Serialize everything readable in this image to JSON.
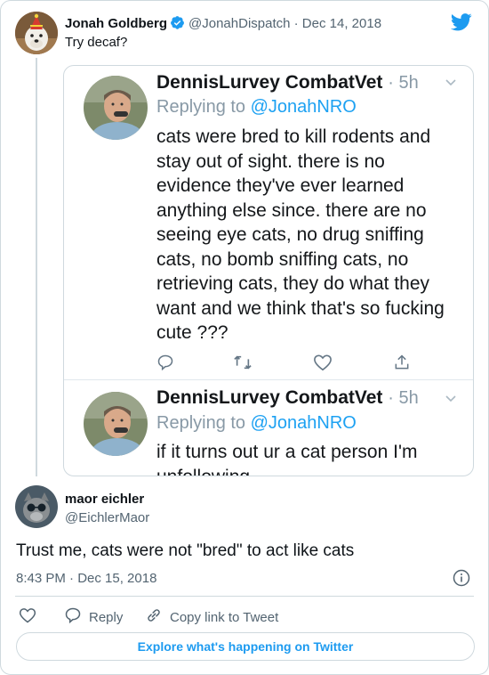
{
  "parent": {
    "name": "Jonah Goldberg",
    "handle_date": "@JonahDispatch · Dec 14, 2018",
    "text": "Try decaf?"
  },
  "screenshot": {
    "tweet1": {
      "name": "DennisLurvey CombatVet",
      "time": "· 5h",
      "replying_prefix": "Replying to",
      "replying_handle": "@JonahNRO",
      "lines": [
        "cats were bred to kill rodents and",
        "stay out of sight. there is no",
        "evidence they've ever learned",
        "anything else since. there are no",
        "seeing eye cats, no drug sniffing",
        "cats, no bomb sniffing cats, no",
        "retrieving cats, they do what they",
        "want and we think that's so fucking",
        "cute ???"
      ]
    },
    "tweet2": {
      "name": "DennisLurvey CombatVet",
      "time": "· 5h",
      "replying_prefix": "Replying to",
      "replying_handle": "@JonahNRO",
      "lines": [
        "if it turns out ur a cat person I'm",
        "unfollowing"
      ]
    }
  },
  "reply": {
    "name": "maor eichler",
    "handle": "@EichlerMaor",
    "text": "Trust me, cats were not \"bred\" to act like cats",
    "timestamp": "8:43 PM · Dec 15, 2018",
    "actions": {
      "reply_label": "Reply",
      "copy_label": "Copy link to Tweet"
    },
    "explore_label": "Explore what's happening on Twitter"
  },
  "colors": {
    "twitter_blue": "#1d9bf0",
    "secondary_text": "#536471",
    "border": "#cfd9de"
  },
  "icons": [
    "verified-badge-icon",
    "twitter-bird-icon",
    "reply-icon",
    "retweet-icon",
    "like-icon",
    "share-icon",
    "info-icon",
    "heart-icon",
    "link-icon",
    "chevron-down-icon"
  ]
}
